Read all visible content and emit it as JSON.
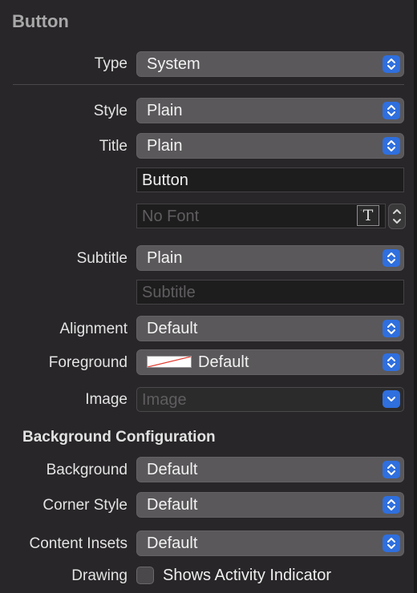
{
  "panel": {
    "section_title": "Button",
    "background_section_title": "Background Configuration"
  },
  "fields": {
    "type": {
      "label": "Type",
      "value": "System"
    },
    "style": {
      "label": "Style",
      "value": "Plain"
    },
    "title": {
      "label": "Title",
      "value": "Plain",
      "text": "Button",
      "font_placeholder": "No Font",
      "font_button_glyph": "T"
    },
    "subtitle": {
      "label": "Subtitle",
      "value": "Plain",
      "placeholder": "Subtitle"
    },
    "alignment": {
      "label": "Alignment",
      "value": "Default"
    },
    "foreground": {
      "label": "Foreground",
      "value": "Default"
    },
    "image": {
      "label": "Image",
      "placeholder": "Image"
    },
    "background": {
      "label": "Background",
      "value": "Default"
    },
    "corner_style": {
      "label": "Corner Style",
      "value": "Default"
    },
    "content_insets": {
      "label": "Content Insets",
      "value": "Default"
    },
    "drawing": {
      "label": "Drawing",
      "checkbox_label": "Shows Activity Indicator",
      "checked": false
    }
  },
  "colors": {
    "accent": "#2f6fde",
    "panel_bg": "#282628",
    "popup_bg": "#5a585a"
  },
  "icons": {
    "popup_indicator": "up-down-chevron-icon",
    "combo_indicator": "chevron-down-icon",
    "font_picker": "font-T-icon"
  }
}
